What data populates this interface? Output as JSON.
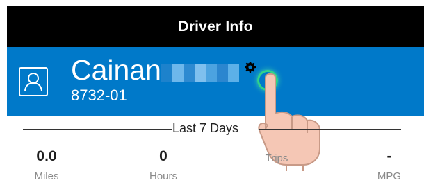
{
  "header": {
    "title": "Driver Info"
  },
  "profile": {
    "name": "Cainan",
    "driver_id": "8732-01",
    "avatar_icon": "person-icon",
    "settings_icon": "gear-icon"
  },
  "summary": {
    "period_label": "Last 7 Days",
    "stats": [
      {
        "value": "0.0",
        "label": "Miles"
      },
      {
        "value": "0",
        "label": "Hours"
      },
      {
        "value": "",
        "label": "Trips"
      },
      {
        "value": "-",
        "label": "MPG"
      }
    ]
  },
  "colors": {
    "header_bg": "#000000",
    "profile_bg": "#0079c9",
    "tap_ring": "#30d38a"
  }
}
